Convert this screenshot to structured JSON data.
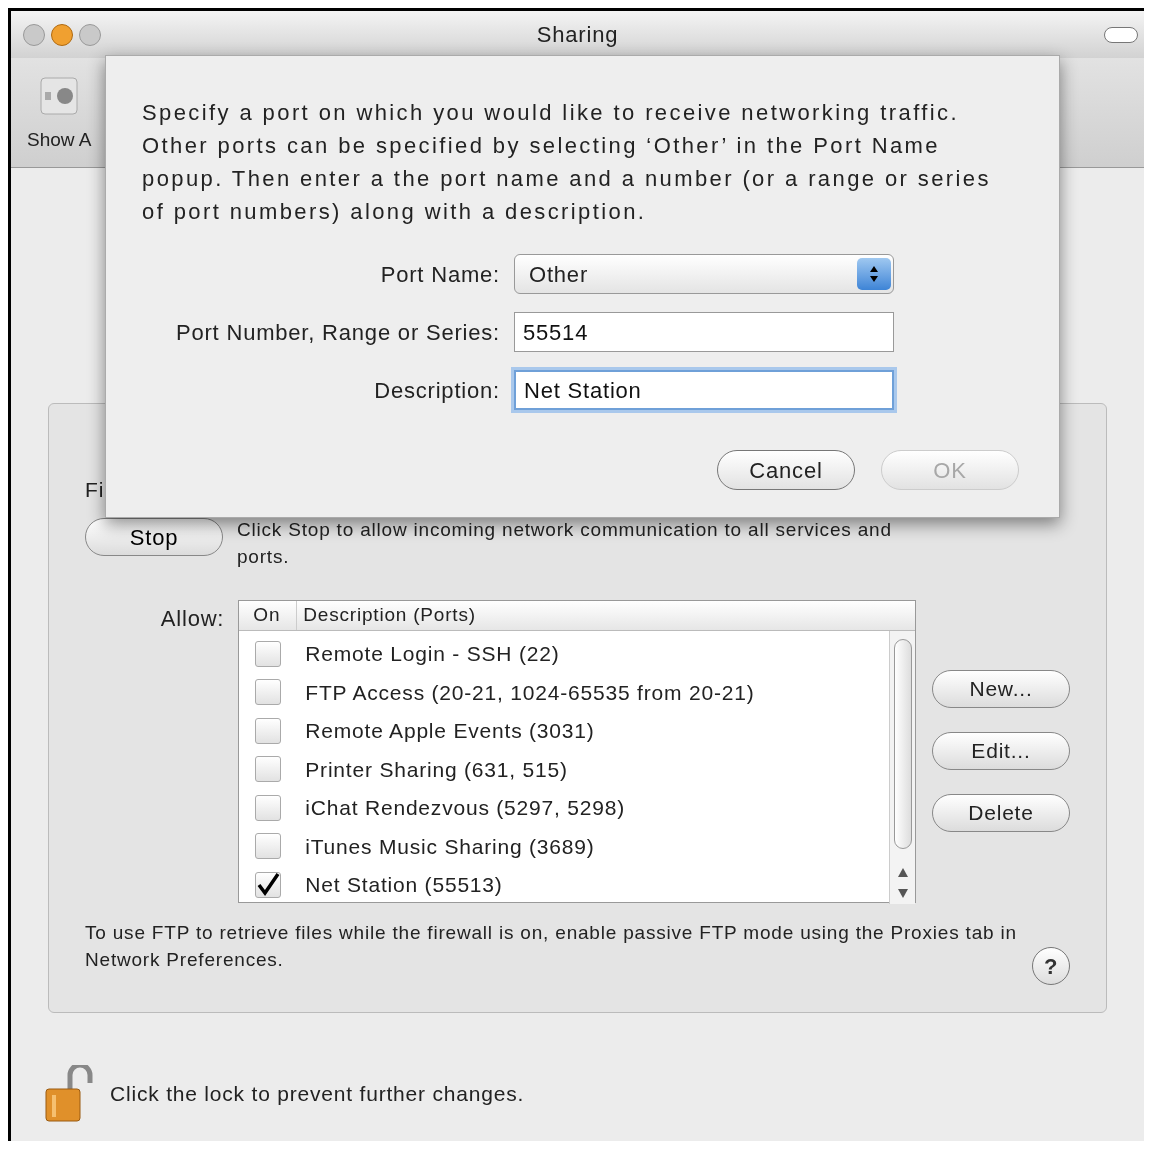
{
  "window": {
    "title": "Sharing"
  },
  "toolbar": {
    "show_all_label": "Show A"
  },
  "sheet": {
    "message": "Specify a port on which you would like to receive networking traffic. Other ports can be specified by selecting ‘Other’ in the Port Name popup. Then enter a the port name and a number (or a range or series of port numbers) along with a description.",
    "fields": [
      {
        "kind": "popup",
        "label": "Port Name:",
        "value": "Other",
        "focused": false
      },
      {
        "kind": "text",
        "label": "Port Number, Range or Series:",
        "value": "55514",
        "focused": false
      },
      {
        "kind": "text",
        "label": "Description:",
        "value": "Net Station",
        "focused": true
      }
    ],
    "buttons": [
      {
        "label": "Cancel",
        "disabled": false
      },
      {
        "label": "OK",
        "disabled": true
      }
    ]
  },
  "firewall": {
    "status_label": "Fi",
    "stop_button": "Stop",
    "stop_note": "Click Stop to allow incoming network communication to all services and ports.",
    "allow_label": "Allow:",
    "columns": [
      "On",
      "Description (Ports)"
    ],
    "rows": [
      {
        "label": "Remote Login - SSH (22)",
        "checked": false
      },
      {
        "label": "FTP Access (20-21, 1024-65535 from 20-21)",
        "checked": false
      },
      {
        "label": "Remote Apple Events (3031)",
        "checked": false
      },
      {
        "label": "Printer Sharing (631, 515)",
        "checked": false
      },
      {
        "label": "iChat Rendezvous (5297, 5298)",
        "checked": false
      },
      {
        "label": "iTunes Music Sharing (3689)",
        "checked": false
      },
      {
        "label": "Net Station (55513)",
        "checked": true
      }
    ],
    "buttons": [
      "New...",
      "Edit...",
      "Delete"
    ],
    "ftp_note": "To use FTP to retrieve files while the firewall is on, enable passive FTP mode using the Proxies tab in Network Preferences.",
    "help": "?"
  },
  "lock": {
    "text": "Click the lock to prevent further changes."
  }
}
